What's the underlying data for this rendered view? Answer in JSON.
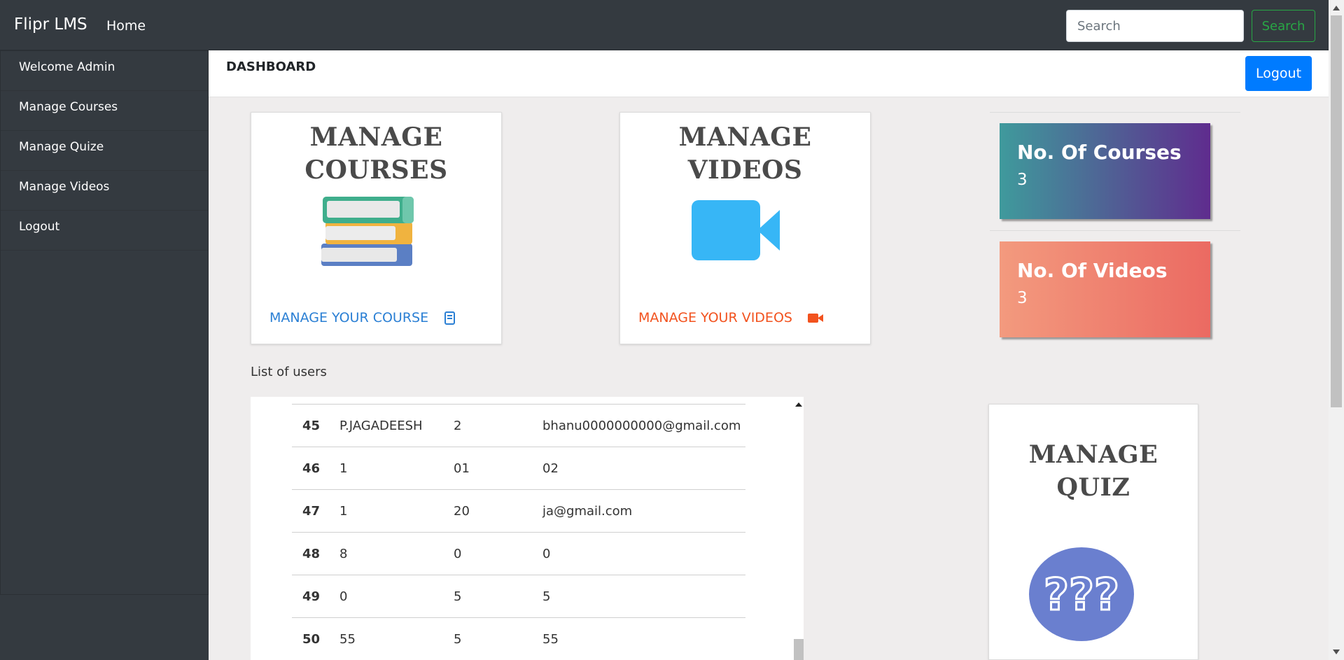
{
  "navbar": {
    "brand": "Flipr LMS",
    "home_label": "Home",
    "search_placeholder": "Search",
    "search_button": "Search"
  },
  "sidebar": {
    "items": [
      {
        "label": "Welcome Admin"
      },
      {
        "label": "Manage Courses"
      },
      {
        "label": "Manage Quize"
      },
      {
        "label": "Manage Videos"
      },
      {
        "label": "Logout"
      }
    ]
  },
  "header": {
    "title": "DASHBOARD",
    "logout_label": "Logout"
  },
  "cards": {
    "courses": {
      "title_line1": "MANAGE",
      "title_line2": "COURSES",
      "link": "MANAGE YOUR COURSE",
      "icon": "book-icon",
      "link_color": "#2a7fd4"
    },
    "videos": {
      "title_line1": "MANAGE",
      "title_line2": "VIDEOS",
      "link": "MANAGE YOUR VIDEOS",
      "icon": "video-camera-icon",
      "link_color": "#f2521e"
    },
    "quiz": {
      "title_line1": "MANAGE",
      "title_line2": "QUIZ",
      "icon": "question-marks-icon"
    }
  },
  "stats": {
    "courses": {
      "label": "No. Of Courses",
      "value": "3",
      "gradient": [
        "#3f9a9c",
        "#5f2c8e"
      ]
    },
    "videos": {
      "label": "No. Of Videos",
      "value": "3",
      "gradient": [
        "#f39a7e",
        "#eb6a62"
      ]
    }
  },
  "users": {
    "label": "List of users",
    "rows": [
      {
        "id": "45",
        "c1": "P.JAGADEESH",
        "c2": "2",
        "c3": "bhanu0000000000@gmail.com"
      },
      {
        "id": "46",
        "c1": "1",
        "c2": "01",
        "c3": "02"
      },
      {
        "id": "47",
        "c1": "1",
        "c2": "20",
        "c3": "ja@gmail.com"
      },
      {
        "id": "48",
        "c1": "8",
        "c2": "0",
        "c3": "0"
      },
      {
        "id": "49",
        "c1": "0",
        "c2": "5",
        "c3": "5"
      },
      {
        "id": "50",
        "c1": "55",
        "c2": "5",
        "c3": "55"
      }
    ]
  }
}
